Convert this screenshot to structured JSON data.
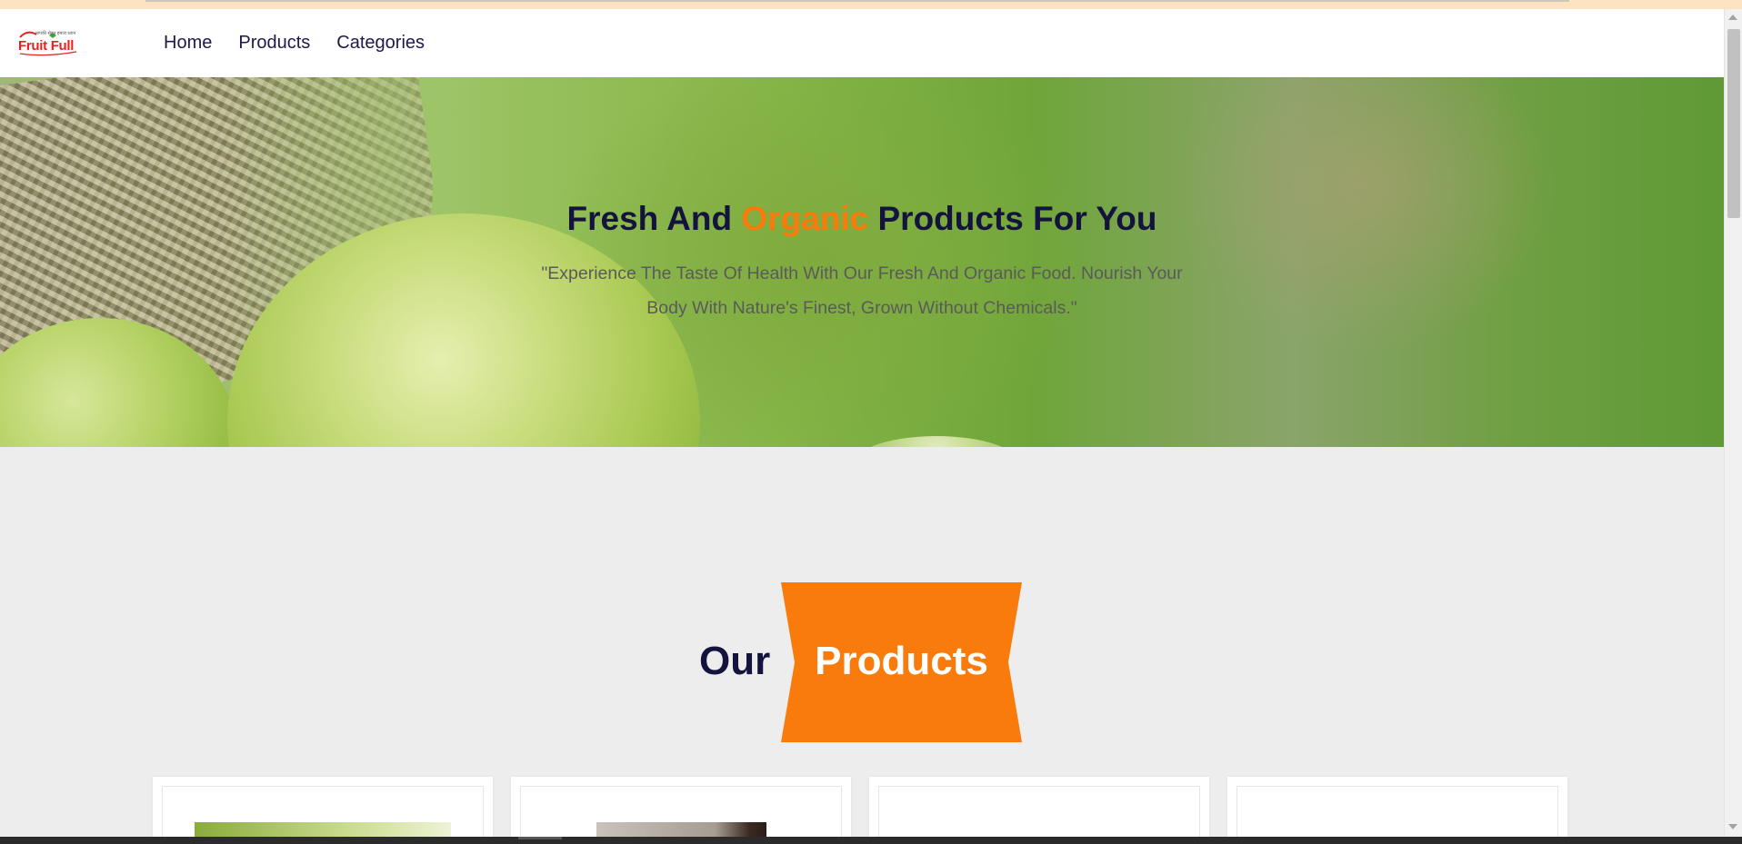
{
  "nav": {
    "logo_brand": "Fruit Full",
    "logo_tagline": "आपकी सेहत हमारा ध्यान",
    "links": [
      "Home",
      "Products",
      "Categories"
    ]
  },
  "hero": {
    "title_part1": "Fresh And ",
    "title_accent": "Organic",
    "title_part2": " Products For You",
    "subtitle": "\"Experience The Taste Of Health With Our Fresh And Organic Food. Nourish Your Body With Nature's Finest, Grown Without Chemicals.\""
  },
  "section": {
    "heading_left": "Our",
    "heading_ribbon": "Products"
  },
  "colors": {
    "accent": "#f97b0b",
    "navy": "#13133e",
    "nav_text": "#1b1a4a",
    "page_bg": "#ededed"
  }
}
